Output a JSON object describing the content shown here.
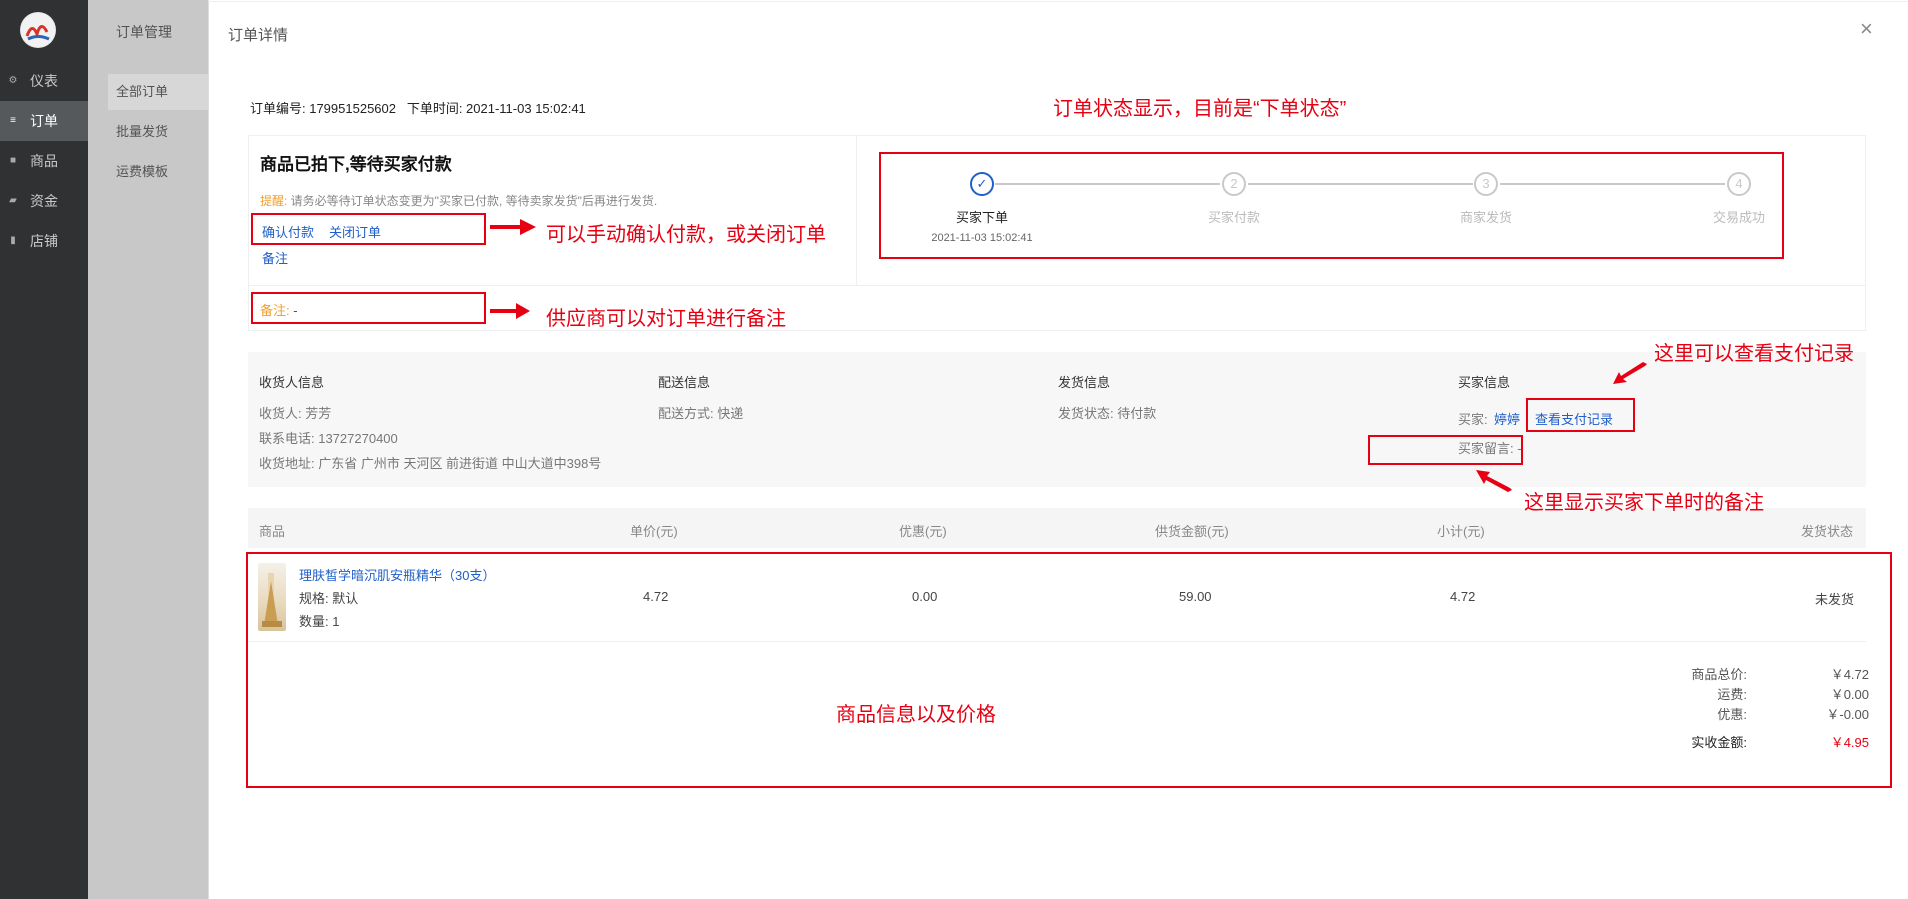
{
  "sidebar": {
    "items": [
      {
        "label": "仪表",
        "icon": "gear-icon"
      },
      {
        "label": "订单",
        "icon": "list-icon"
      },
      {
        "label": "商品",
        "icon": "bag-icon"
      },
      {
        "label": "资金",
        "icon": "wallet-icon"
      },
      {
        "label": "店铺",
        "icon": "store-icon"
      }
    ]
  },
  "submenu": {
    "title": "订单管理",
    "items": [
      "全部订单",
      "批量发货",
      "运费模板"
    ]
  },
  "modal": {
    "title": "订单详情",
    "close": "×"
  },
  "order": {
    "meta": "订单编号: 179951525602   下单时间: 2021-11-03 15:02:41",
    "status_heading": "商品已拍下,等待买家付款",
    "reminder_key": "提醒:",
    "reminder_text": " 请务必等待订单状态变更为\"买家已付款, 等待卖家发货\"后再进行发货.",
    "confirm_pay": "确认付款",
    "close_order": "关闭订单",
    "remark_link": "备注",
    "remark_key": "备注:",
    "remark_value": " -"
  },
  "steps": [
    {
      "num": "✓",
      "label": "买家下单",
      "time": "2021-11-03 15:02:41",
      "done": true
    },
    {
      "num": "2",
      "label": "买家付款",
      "time": "",
      "done": false
    },
    {
      "num": "3",
      "label": "商家发货",
      "time": "",
      "done": false
    },
    {
      "num": "4",
      "label": "交易成功",
      "time": "",
      "done": false
    }
  ],
  "info": {
    "receiver_title": "收货人信息",
    "receiver_name": "收货人: 芳芳",
    "receiver_phone": "联系电话: 13727270400",
    "receiver_addr": "收货地址: 广东省 广州市 天河区 前进街道 中山大道中398号",
    "delivery_title": "配送信息",
    "delivery_method": "配送方式: 快递",
    "ship_title": "发货信息",
    "ship_status": "发货状态: 待付款",
    "buyer_title": "买家信息",
    "buyer_key": "买家:",
    "buyer_name": "婷婷",
    "pay_record": "查看支付记录",
    "buyer_msg": "买家留言: -"
  },
  "table": {
    "headers": [
      "商品",
      "单价(元)",
      "优惠(元)",
      "供货金额(元)",
      "小计(元)",
      "发货状态"
    ],
    "row": {
      "name": "理肤皙学暗沉肌安瓶精华（30支）",
      "spec": "规格: 默认",
      "qty": "数量: 1",
      "price": "4.72",
      "discount": "0.00",
      "supply": "59.00",
      "subtotal": "4.72",
      "ship_status": "未发货"
    }
  },
  "summary": {
    "total_label": "商品总价:",
    "total": "￥4.72",
    "freight_label": "运费:",
    "freight": "￥0.00",
    "discount_label": "优惠:",
    "discount": "￥-0.00",
    "paid_label": "实收金额:",
    "paid": "￥4.95"
  },
  "annotations": {
    "status": "订单状态显示，目前是“下单状态”",
    "confirm": "可以手动确认付款，或关闭订单",
    "remark": "供应商可以对订单进行备注",
    "pay_record": "这里可以查看支付记录",
    "buyer_msg": "这里显示买家下单时的备注",
    "goods": "商品信息以及价格"
  },
  "colors": {
    "annotation": "#e60012",
    "link": "#1f5fc8",
    "warn": "#f0a030",
    "price": "#e60012"
  }
}
